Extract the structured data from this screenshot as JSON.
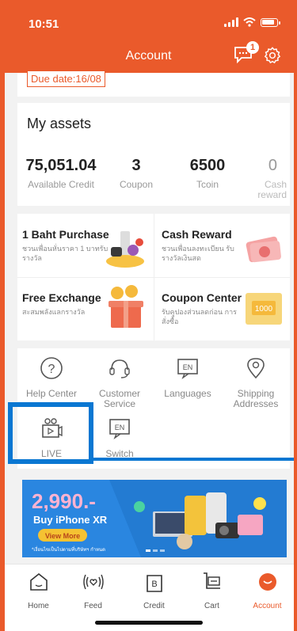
{
  "status": {
    "time": "10:51"
  },
  "header": {
    "title": "Account",
    "chat_badge": "1"
  },
  "top_card": {
    "due": "Due date:16/08"
  },
  "assets": {
    "title": "My assets",
    "items": [
      {
        "value": "75,051.04",
        "label": "Available Credit"
      },
      {
        "value": "3",
        "label": "Coupon"
      },
      {
        "value": "6500",
        "label": "Tcoin"
      },
      {
        "value": "0",
        "label": "Cash reward"
      }
    ]
  },
  "promos": [
    {
      "title": "1 Baht Purchase",
      "sub": "ชวนเพื่อนหั่นราคา 1 บาทรับรางวัล",
      "icon": "gift-products-icon"
    },
    {
      "title": "Cash Reward",
      "sub": "ชวนเพื่อนลงทะเบียน รับรางวัลเงินสด",
      "icon": "cash-icon"
    },
    {
      "title": "Free Exchange",
      "sub": "สะสมพลังแลกรางวัล",
      "icon": "gift-box-coins-icon"
    },
    {
      "title": "Coupon Center",
      "sub": "รับคูปองส่วนลดก่อน การสั่งซื้อ",
      "icon": "coupon-icon",
      "coupon_value": "1000"
    }
  ],
  "services": [
    {
      "label": "Help Center",
      "icon": "help-icon"
    },
    {
      "label": "Customer Service",
      "icon": "headset-icon"
    },
    {
      "label": "Languages",
      "icon": "language-icon",
      "glyph": "EN"
    },
    {
      "label": "Shipping Addresses",
      "icon": "location-pin-icon"
    },
    {
      "label": "LIVE",
      "icon": "live-camera-icon"
    },
    {
      "label": "Switch",
      "icon": "switch-icon",
      "glyph": "EN"
    }
  ],
  "banner": {
    "price": "2,990.-",
    "headline": "Buy iPhone XR",
    "cta": "View More",
    "fineprint": "*เงื่อนไขเป็นไปตามที่บริษัทฯ กำหนด"
  },
  "tabs": [
    {
      "label": "Home",
      "icon": "home-icon"
    },
    {
      "label": "Feed",
      "icon": "feed-icon"
    },
    {
      "label": "Credit",
      "icon": "credit-icon"
    },
    {
      "label": "Cart",
      "icon": "cart-icon"
    },
    {
      "label": "Account",
      "icon": "account-icon",
      "active": true
    }
  ],
  "colors": {
    "accent": "#ea5a2b",
    "highlight": "#0a77d2"
  }
}
